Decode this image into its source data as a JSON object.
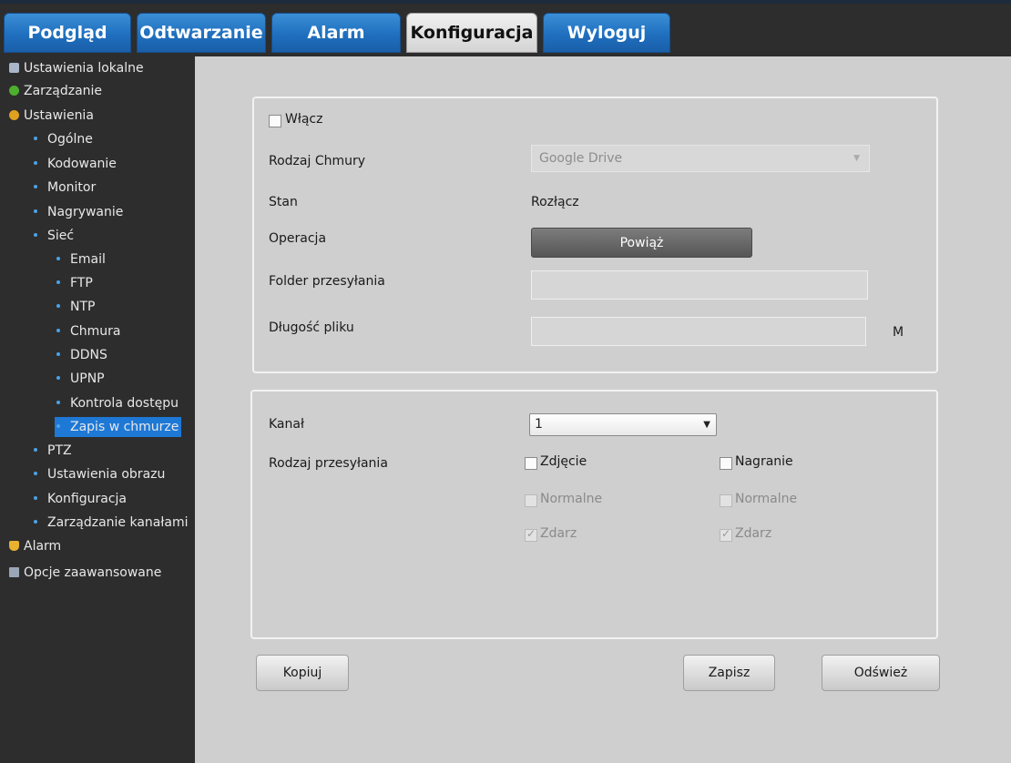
{
  "tabs": [
    {
      "label": "Podgląd"
    },
    {
      "label": "Odtwarzanie"
    },
    {
      "label": "Alarm"
    },
    {
      "label": "Konfiguracja"
    },
    {
      "label": "Wyloguj"
    }
  ],
  "sidebar": {
    "items": [
      {
        "label": "Ustawienia lokalne"
      },
      {
        "label": "Zarządzanie"
      },
      {
        "label": "Ustawienia"
      },
      {
        "label": "Ogólne"
      },
      {
        "label": "Kodowanie"
      },
      {
        "label": "Monitor"
      },
      {
        "label": "Nagrywanie"
      },
      {
        "label": "Sieć"
      },
      {
        "label": "Email"
      },
      {
        "label": "FTP"
      },
      {
        "label": "NTP"
      },
      {
        "label": "Chmura"
      },
      {
        "label": "DDNS"
      },
      {
        "label": "UPNP"
      },
      {
        "label": "Kontrola dostępu"
      },
      {
        "label": "Zapis w chmurze"
      },
      {
        "label": "PTZ"
      },
      {
        "label": "Ustawienia obrazu"
      },
      {
        "label": "Konfiguracja"
      },
      {
        "label": "Zarządzanie kanałami"
      },
      {
        "label": "Alarm"
      },
      {
        "label": "Opcje zaawansowane"
      }
    ]
  },
  "cloud": {
    "enable_label": "Włącz",
    "enable_checked": false,
    "type_label": "Rodzaj Chmury",
    "type_value": "Google Drive",
    "status_label": "Stan",
    "status_value": "Rozłącz",
    "operation_label": "Operacja",
    "bind_button": "Powiąż",
    "folder_label": "Folder przesyłania",
    "folder_value": "",
    "file_length_label": "Długość pliku",
    "file_length_value": "",
    "file_length_unit": "M"
  },
  "upload": {
    "channel_label": "Kanał",
    "channel_value": "1",
    "type_label": "Rodzaj przesyłania",
    "photo_label": "Zdjęcie",
    "recording_label": "Nagranie",
    "normal_label": "Normalne",
    "event_label": "Zdarz"
  },
  "buttons": {
    "copy": "Kopiuj",
    "save": "Zapisz",
    "refresh": "Odśwież"
  },
  "colors": {
    "tab_blue": "#1f6fbf",
    "selected_item": "#1e78d6",
    "content_bg": "#cfcfcf"
  }
}
